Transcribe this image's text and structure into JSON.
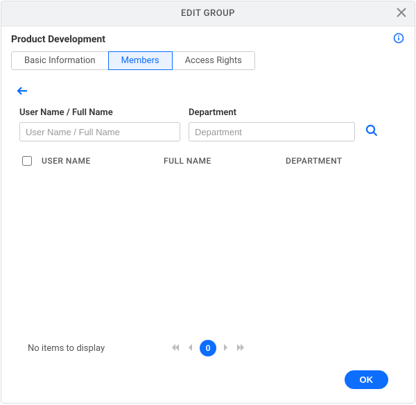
{
  "dialog": {
    "title": "EDIT GROUP",
    "group_name": "Product Development"
  },
  "tabs": [
    {
      "label": "Basic Information",
      "selected": false
    },
    {
      "label": "Members",
      "selected": true
    },
    {
      "label": "Access Rights",
      "selected": false
    }
  ],
  "search": {
    "username_label": "User Name / Full Name",
    "username_placeholder": "User Name / Full Name",
    "username_value": "",
    "department_label": "Department",
    "department_placeholder": "Department",
    "department_value": ""
  },
  "table": {
    "columns": {
      "username": "USER NAME",
      "fullname": "FULL NAME",
      "department": "DEPARTMENT"
    },
    "rows": []
  },
  "pager": {
    "no_items": "No items to display",
    "current_page": "0"
  },
  "footer": {
    "ok_label": "OK"
  }
}
